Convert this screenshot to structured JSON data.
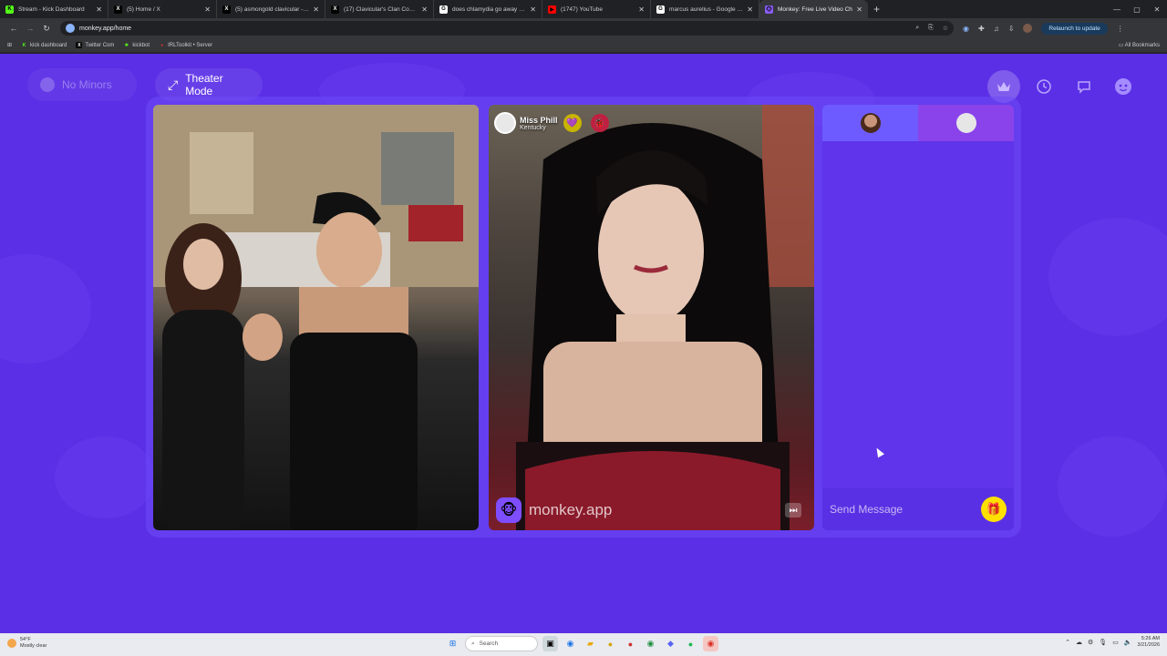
{
  "browser": {
    "tabs": [
      {
        "title": "Stream - Kick Dashboard",
        "favicon": "K",
        "color": "#53fc18"
      },
      {
        "title": "(5) Home / X",
        "favicon": "X",
        "color": "#000000"
      },
      {
        "title": "(5) asmongold clavicular - Sear",
        "favicon": "X",
        "color": "#000000"
      },
      {
        "title": "(17) Clavicular's Clan Communi",
        "favicon": "X",
        "color": "#000000"
      },
      {
        "title": "does chlamydia go away - Goo",
        "favicon": "G",
        "color": "#ffffff"
      },
      {
        "title": "(1747) YouTube",
        "favicon": "▶",
        "color": "#ff0000"
      },
      {
        "title": "marcus aurelius - Google Sear",
        "favicon": "G",
        "color": "#ffffff"
      },
      {
        "title": "Monkey: Free Live Video Ch",
        "favicon": "🐵",
        "color": "#8a5cf6",
        "active": true
      }
    ],
    "new_tab": "+",
    "window_controls": [
      "—",
      "▢",
      "✕"
    ],
    "url": "monkey.app/home",
    "relaunch_label": "Relaunch to update",
    "bookmarks": [
      {
        "label": "kick dashboard",
        "icon": "K",
        "color": "#53fc18"
      },
      {
        "label": "Twitter Com",
        "icon": "X",
        "color": "#000000"
      },
      {
        "label": "kickbot",
        "icon": "✱",
        "color": "#53fc18"
      },
      {
        "label": "IRLToolkit • Server",
        "icon": "●",
        "color": "#d03030"
      }
    ],
    "all_bookmarks_label": "All Bookmarks"
  },
  "page": {
    "no_minors_label": "No Minors",
    "theater_mode_label": "Theater Mode",
    "remote_user": {
      "name": "Miss Phill",
      "location": "Kentucky"
    },
    "watermark": "monkey.app",
    "chat": {
      "placeholder": "Send Message"
    },
    "accent": "#5b2fe6",
    "gift_color": "#ffe100"
  },
  "taskbar": {
    "weather_temp": "54°F",
    "weather_desc": "Mostly clear",
    "search_label": "Search",
    "time": "5:26 AM",
    "date": "3/21/2026"
  }
}
